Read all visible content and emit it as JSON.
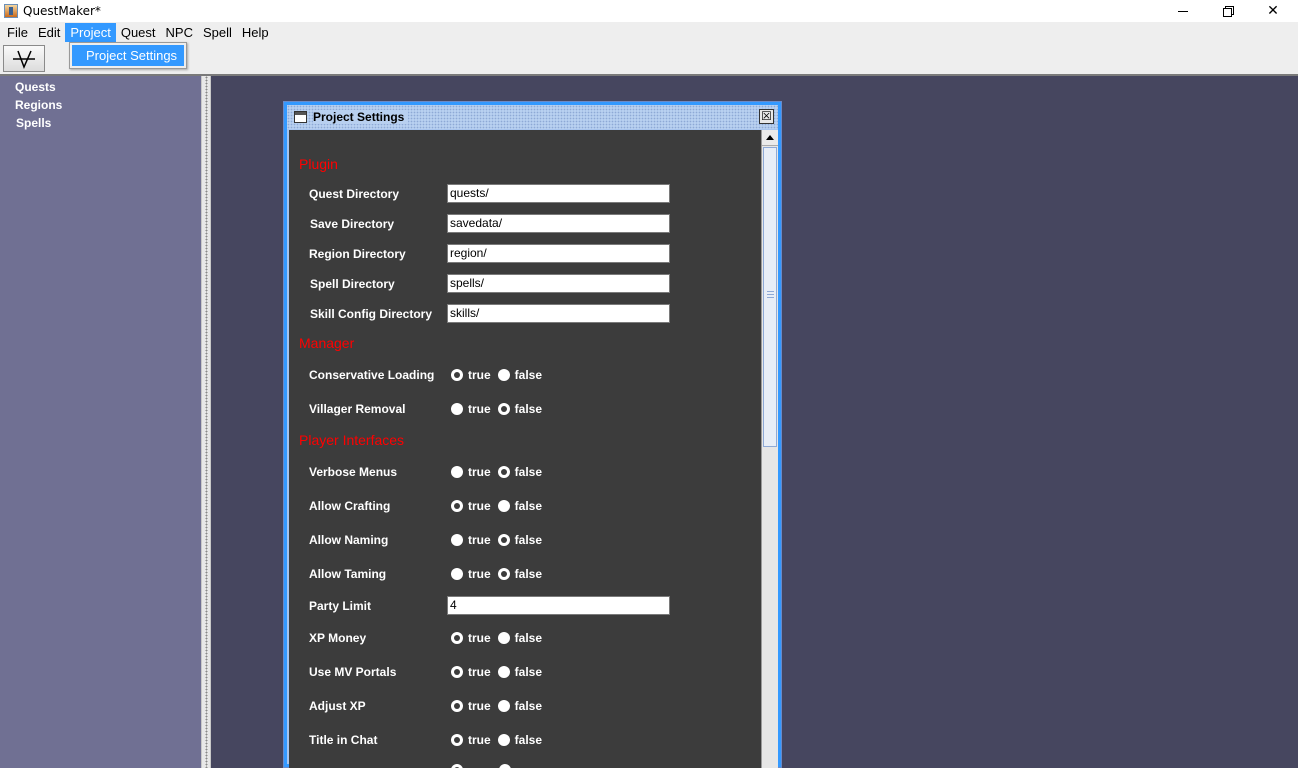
{
  "window": {
    "title": "QuestMaker*"
  },
  "menubar": [
    "File",
    "Edit",
    "Project",
    "Quest",
    "NPC",
    "Spell",
    "Help"
  ],
  "dropdown": {
    "item": "Project Settings"
  },
  "sidebar": {
    "items": [
      "Quests",
      "Regions",
      "Spells"
    ]
  },
  "frame": {
    "title": "Project Settings",
    "sections": {
      "plugin": "Plugin",
      "manager": "Manager",
      "player_interfaces": "Player Interfaces"
    },
    "fields": [
      {
        "label": "Quest Directory",
        "value": "quests/"
      },
      {
        "label": "Save Directory",
        "value": "savedata/"
      },
      {
        "label": "Region Directory",
        "value": "region/"
      },
      {
        "label": "Spell Directory",
        "value": "spells/"
      },
      {
        "label": "Skill Config Directory",
        "value": "skills/"
      },
      {
        "label": "Conservative Loading",
        "selected": "true"
      },
      {
        "label": "Villager Removal",
        "selected": "false"
      },
      {
        "label": "Verbose Menus",
        "selected": "false"
      },
      {
        "label": "Allow Crafting",
        "selected": "true"
      },
      {
        "label": "Allow Naming",
        "selected": "false"
      },
      {
        "label": "Allow Taming",
        "selected": "false"
      },
      {
        "label": "Party Limit",
        "value": "4"
      },
      {
        "label": "XP Money",
        "selected": "true"
      },
      {
        "label": "Use MV Portals",
        "selected": "true"
      },
      {
        "label": "Adjust XP",
        "selected": "true"
      },
      {
        "label": "Title in Chat",
        "selected": "true"
      }
    ],
    "radio_labels": {
      "true": "true",
      "false": "false"
    }
  },
  "colors": {
    "desktop": "#46465f",
    "sidebar": "#707093",
    "content": "#3c3c3c",
    "section_header": "#ff0000",
    "menu_highlight": "#3399ff"
  }
}
